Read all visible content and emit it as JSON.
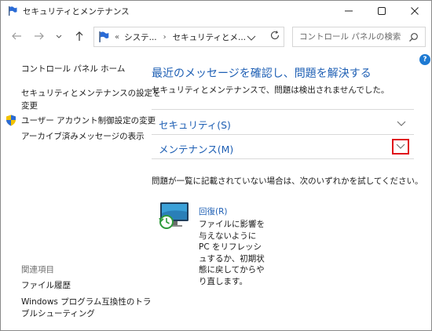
{
  "window": {
    "title": "セキュリティとメンテナンス"
  },
  "address_bar": {
    "overflow_symbol": "«",
    "segments": [
      "システ...",
      "セキュリティとメ..."
    ],
    "separator": "›"
  },
  "search": {
    "placeholder": "コントロール パネルの検索"
  },
  "help": {
    "label": "?"
  },
  "left_nav": {
    "home": "コントロール パネル ホーム",
    "change_settings_line1": "セキュリティとメンテナンスの設定を",
    "change_settings_line2": "変更",
    "uac_settings": "ユーザー アカウント制御設定の変更",
    "archived_messages": "アーカイブ済みメッセージの表示",
    "related_title": "関連項目",
    "file_history": "ファイル履歴",
    "compat_line1": "Windows プログラム互換性のトラ",
    "compat_line2": "ブルシューティング"
  },
  "main": {
    "heading": "最近のメッセージを確認し、問題を解決する",
    "subtext": "セキュリティとメンテナンスで、問題は検出されませんでした。",
    "security_label": "セキュリティ(S)",
    "maintenance_label": "メンテナンス(M)",
    "hint": "問題が一覧に記載されていない場合は、次のいずれかを試してください。",
    "recovery_link": "回復(R)",
    "recovery_desc": "ファイルに影響を与えないように PC をリフレッシュするか、初期状態に戻してからやり直します。"
  },
  "colors": {
    "link_blue": "#1e5fb4",
    "highlight_red": "#e0101a",
    "help_blue": "#1e7ad3"
  }
}
